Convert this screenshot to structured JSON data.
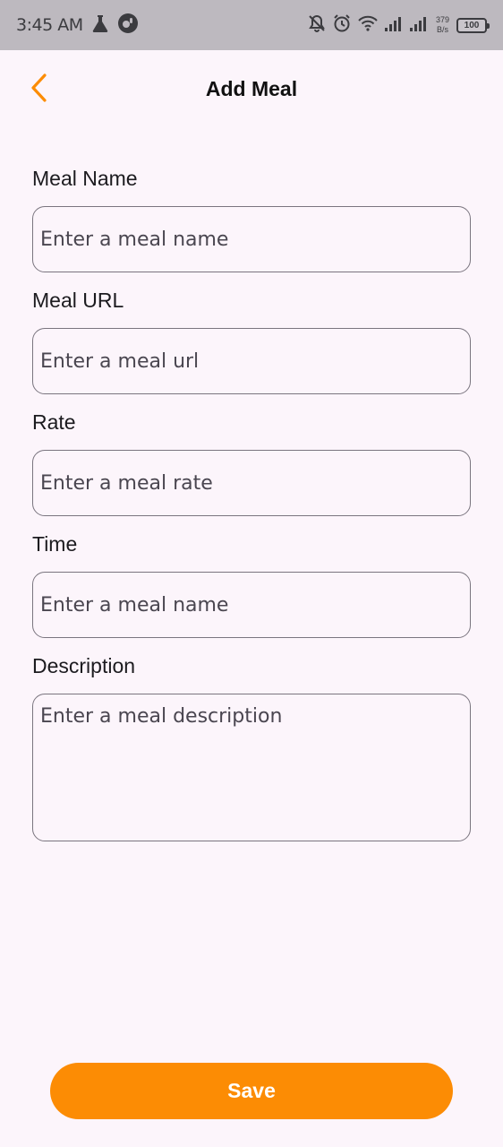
{
  "status_bar": {
    "time": "3:45 AM",
    "speed_value": "379",
    "speed_unit": "B/s",
    "battery": "100",
    "icons": [
      "flask-icon",
      "app-circle-icon",
      "bell-off-icon",
      "alarm-icon",
      "wifi-icon",
      "signal-icon",
      "signal-icon",
      "battery-icon"
    ]
  },
  "app_bar": {
    "title": "Add Meal",
    "back_icon": "chevron-left-icon",
    "accent_color": "#fc8c04"
  },
  "form": {
    "meal_name": {
      "label": "Meal Name",
      "placeholder": "Enter a meal name",
      "value": ""
    },
    "meal_url": {
      "label": "Meal URL",
      "placeholder": "Enter a meal url",
      "value": ""
    },
    "rate": {
      "label": "Rate",
      "placeholder": "Enter a meal rate",
      "value": ""
    },
    "time": {
      "label": "Time",
      "placeholder": "Enter a meal name",
      "value": ""
    },
    "description": {
      "label": "Description",
      "placeholder": "Enter a meal description",
      "value": ""
    }
  },
  "actions": {
    "save_label": "Save",
    "save_color": "#fc8c04"
  }
}
